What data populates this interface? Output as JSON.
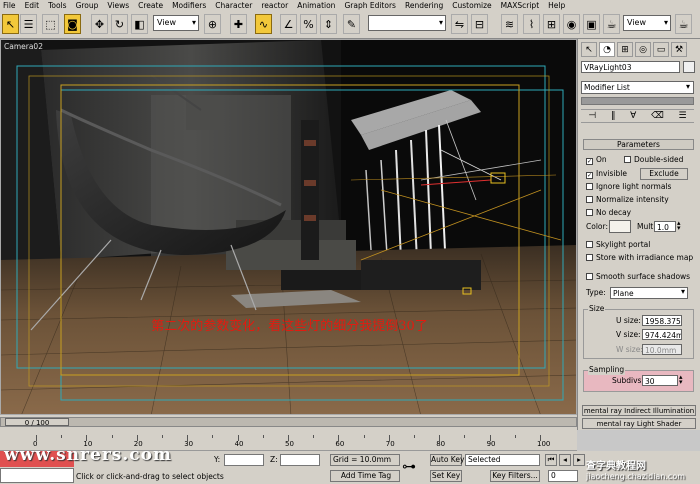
{
  "menu": [
    "File",
    "Edit",
    "Tools",
    "Group",
    "Views",
    "Create",
    "Modifiers",
    "Character",
    "reactor",
    "Animation",
    "Graph Editors",
    "Rendering",
    "Customize",
    "MAXScript",
    "Help"
  ],
  "toolbar": {
    "view_dropdown": "View",
    "named_sel": "",
    "right_view_dropdown": "View",
    "icons": [
      "select-icon",
      "select-region-icon",
      "window-crossing-icon",
      "move-icon",
      "rotate-icon",
      "scale-icon",
      "snap-icon",
      "angle-snap-icon",
      "percent-snap-icon",
      "spinner-snap-icon",
      "mirror-icon",
      "align-icon",
      "layer-icon",
      "render-icon"
    ]
  },
  "viewport": {
    "label": "Camera02",
    "caption": "第二次的参数变化，看这些灯的细分我提倒30了"
  },
  "panel": {
    "tabs": [
      "create-tab",
      "modify-tab",
      "hierarchy-tab",
      "motion-tab",
      "display-tab",
      "utilities-tab"
    ],
    "object_name": "VRayLight03",
    "modifier_list": "Modifier List",
    "parameters_title": "Parameters",
    "on": "On",
    "double_sided": "Double-sided",
    "invisible": "Invisible",
    "exclude": "Exclude",
    "ignore_normals": "Ignore light normals",
    "normalize": "Normalize intensity",
    "no_decay": "No decay",
    "color_label": "Color:",
    "mult_label": "Mult:",
    "mult_value": "1.0",
    "skylight": "Skylight portal",
    "store_irradiance": "Store with irradiance map",
    "smooth_shadows": "Smooth surface shadows",
    "type_label": "Type:",
    "type_value": "Plane",
    "size_title": "Size",
    "usize_label": "U size:",
    "usize_value": "1958.375",
    "vsize_label": "V size:",
    "vsize_value": "974.424m",
    "wsize_label": "W size:",
    "wsize_value": "10.0mm",
    "sampling_title": "Sampling",
    "subdivs_label": "Subdivs:",
    "subdivs_value": "30",
    "mr_illum": "mental ray Indirect Illumination",
    "mr_shader": "mental ray Light Shader"
  },
  "timeline": {
    "slider_text": "0 / 100",
    "ticks": [
      "0",
      "10",
      "20",
      "30",
      "40",
      "50",
      "60",
      "70",
      "80",
      "90",
      "100"
    ]
  },
  "status": {
    "y_label": "Y:",
    "y_value": "",
    "z_label": "Z:",
    "z_value": "",
    "grid": "Grid = 10.0mm",
    "autokey": "Auto Key",
    "selected": "Selected",
    "setkey": "Set Key",
    "keyfilters": "Key Filters...",
    "add_time_tag": "Add Time Tag",
    "prompt": "Click or click-and-drag to select objects",
    "frame": "0"
  },
  "watermarks": {
    "left": "www.snrers.com",
    "right_top": "查字典教程网",
    "right_bottom": "jiaocheng.chazidian.com"
  }
}
